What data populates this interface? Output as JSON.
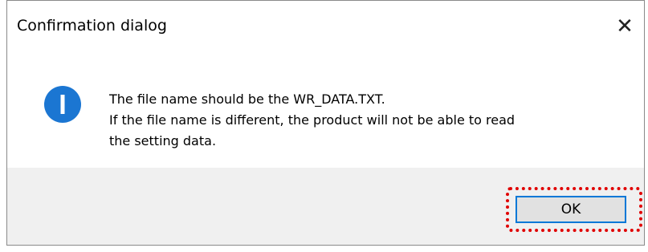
{
  "window": {
    "title": "Confirmation dialog",
    "close_glyph": "✕"
  },
  "message": {
    "line1": "The file name should be the WR_DATA.TXT.",
    "line2": "If the file name is different, the product will not be able to read",
    "line3": "the setting data."
  },
  "icon": {
    "name": "info-icon",
    "glyph": "i",
    "color": "#1b76d2"
  },
  "buttons": {
    "ok_label": "OK"
  },
  "annotation": {
    "highlight_color": "#e00000"
  }
}
